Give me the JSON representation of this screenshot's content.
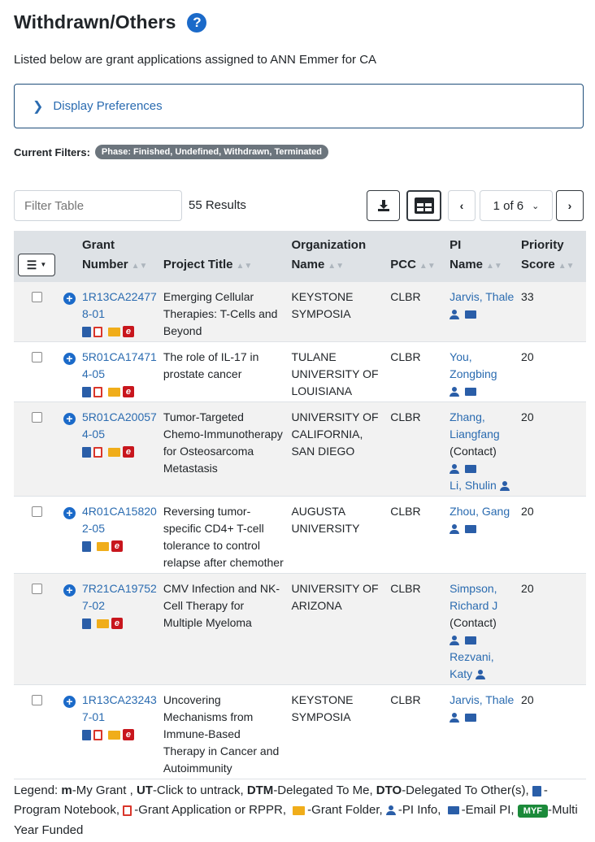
{
  "header": {
    "title": "Withdrawn/Others",
    "help_icon": "question-circle-icon",
    "subtitle": "Listed below are grant applications assigned to ANN Emmer for CA"
  },
  "preferences": {
    "label": "Display Preferences"
  },
  "filters": {
    "label": "Current Filters:",
    "badge": "Phase: Finished, Undefined, Withdrawn, Terminated"
  },
  "toolbar": {
    "filter_placeholder": "Filter Table",
    "results": "55 Results",
    "page": "1 of 6"
  },
  "table": {
    "headers": {
      "grant_1": "Grant",
      "grant_2": "Number",
      "title": "Project Title",
      "org_1": "Organization",
      "org_2": "Name",
      "pcc": "PCC",
      "pi_1": "PI",
      "pi_2": "Name",
      "score_1": "Priority",
      "score_2": "Score"
    },
    "rows": [
      {
        "grant": "1R13CA224778-01",
        "title": "Emerging Cellular Therapies: T-Cells and Beyond",
        "org": "KEYSTONE SYMPOSIA",
        "pcc": "CLBR",
        "pi1": "Jarvis, Thale",
        "pi1_contact": "",
        "pi2": "",
        "score": "33"
      },
      {
        "grant": "5R01CA174714-05",
        "title": "The role of IL-17 in prostate cancer",
        "org": "TULANE UNIVERSITY OF LOUISIANA",
        "pcc": "CLBR",
        "pi1": "You, Zongbing",
        "pi1_contact": "",
        "pi2": "",
        "score": "20"
      },
      {
        "grant": "5R01CA200574-05",
        "title": "Tumor-Targeted Chemo-Immunotherapy for Osteosarcoma Metastasis",
        "org": "UNIVERSITY OF CALIFORNIA, SAN DIEGO",
        "pcc": "CLBR",
        "pi1": "Zhang, Liangfang",
        "pi1_contact": "(Contact)",
        "pi2": "Li, Shulin",
        "score": "20"
      },
      {
        "grant": "4R01CA158202-05",
        "title": "Reversing tumor-specific CD4+ T-cell tolerance to control relapse after chemother",
        "org": "AUGUSTA UNIVERSITY",
        "pcc": "CLBR",
        "pi1": "Zhou, Gang",
        "pi1_contact": "",
        "pi2": "",
        "score": "20"
      },
      {
        "grant": "7R21CA197527-02",
        "title": "CMV Infection and NK-Cell Therapy for Multiple Myeloma",
        "org": "UNIVERSITY OF ARIZONA",
        "pcc": "CLBR",
        "pi1": "Simpson, Richard J",
        "pi1_contact": "(Contact)",
        "pi2": "Rezvani, Katy",
        "score": "20"
      },
      {
        "grant": "1R13CA232437-01",
        "title": "Uncovering Mechanisms from Immune-Based Therapy in Cancer and Autoimmunity",
        "org": "KEYSTONE SYMPOSIA",
        "pcc": "CLBR",
        "pi1": "Jarvis, Thale",
        "pi1_contact": "",
        "pi2": "",
        "score": "20"
      }
    ]
  },
  "legend": {
    "prefix": "Legend:",
    "m": "m",
    "m_desc": "-My Grant ,",
    "ut": "UT",
    "ut_desc": "-Click to untrack,",
    "dtm": "DTM",
    "dtm_desc": "-Delegated To Me,",
    "dto": "DTO",
    "dto_desc": "-Delegated To Other(s),",
    "notebook": "-Program Notebook,",
    "application": "-Grant Application or RPPR,",
    "folder": "-Grant Folder,",
    "pi_info": "-PI Info,",
    "email": "-Email PI,",
    "myf": "MYF",
    "myf_desc": "-Multi Year Funded"
  }
}
